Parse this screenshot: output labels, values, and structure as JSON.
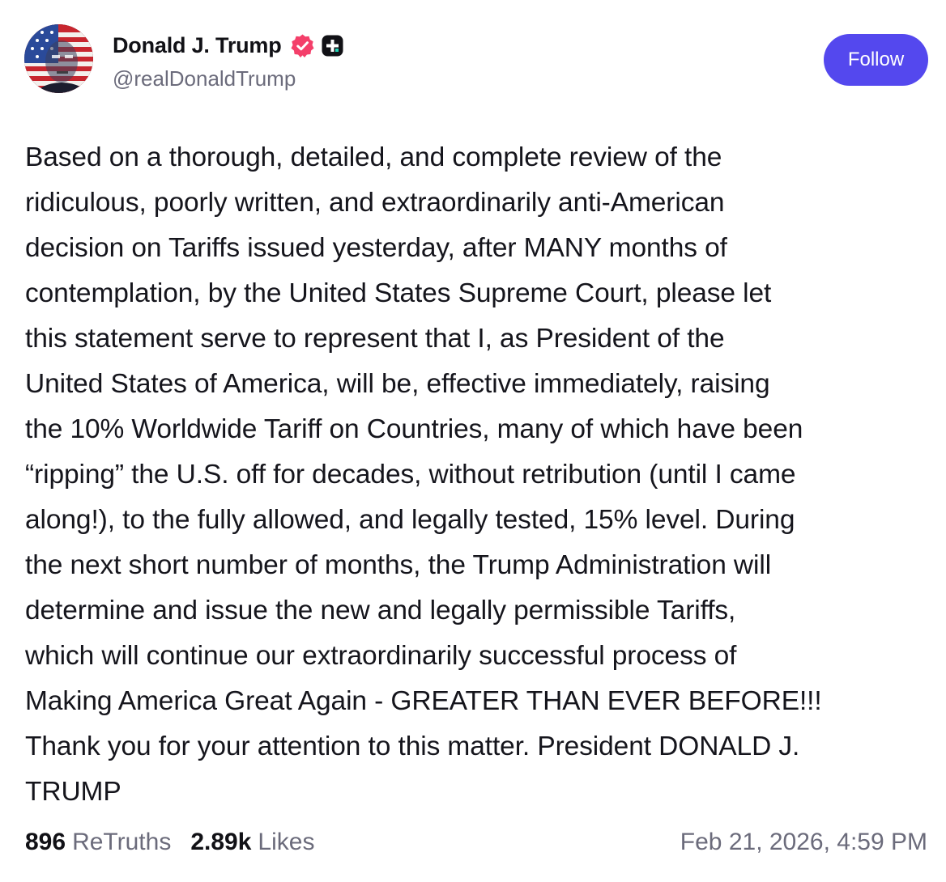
{
  "author": {
    "display_name": "Donald J. Trump",
    "handle": "@realDonaldTrump",
    "avatar_icon": "avatar-flag-portrait",
    "verified_icon": "verified-badge-icon",
    "verified_color": "#f43f6a",
    "plus_icon": "truth-plus-icon"
  },
  "follow_button": {
    "label": "Follow",
    "color": "#5448ee"
  },
  "post": {
    "lines": [
      "Based on a thorough, detailed, and complete review of the",
      "ridiculous, poorly written, and extraordinarily anti-American",
      "decision on Tariffs issued yesterday, after MANY months of",
      "contemplation, by the United States Supreme Court, please let",
      "this statement serve to represent that I, as President of the",
      "United States of America, will be, effective immediately, raising",
      "the 10% Worldwide Tariff on Countries, many of which have been",
      "“ripping” the U.S. off for decades, without retribution (until I came",
      "along!), to the fully allowed, and legally tested, 15% level. During",
      "the next short number of months, the Trump Administration will",
      "determine and issue the new and legally permissible Tariffs,",
      "which will continue our extraordinarily successful process of",
      "Making America Great Again - GREATER THAN EVER BEFORE!!!",
      "Thank you for your attention to this matter. President DONALD J.",
      "TRUMP"
    ]
  },
  "stats": {
    "retruths_count": "896",
    "retruths_label": "ReTruths",
    "likes_count": "2.89k",
    "likes_label": "Likes"
  },
  "timestamp": "Feb 21, 2026, 4:59 PM"
}
